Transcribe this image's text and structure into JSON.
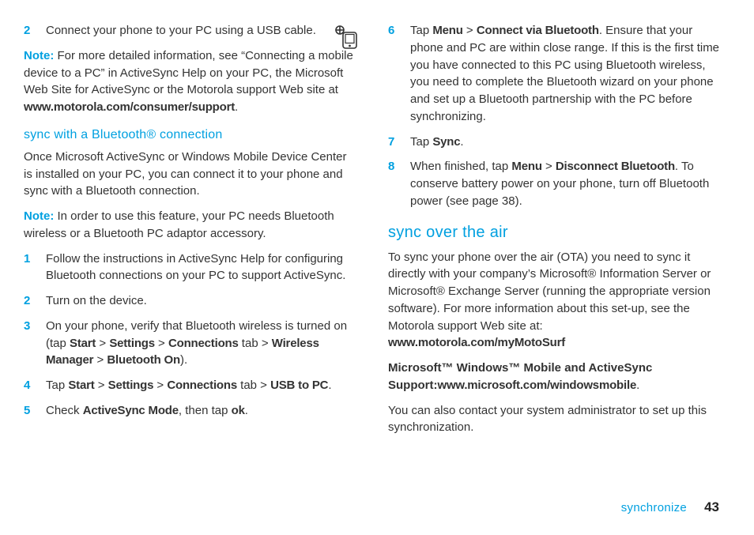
{
  "left": {
    "step2": {
      "num": "2",
      "text_a": "Connect your phone to your PC using a USB cable."
    },
    "note1_label": "Note:",
    "note1_text": " For more detailed information, see “Connecting a mobile device to a PC” in ActiveSync Help on your PC, the Microsoft Web Site for ActiveSync or the Motorola support Web site at ",
    "note1_url": "www.motorola.com/consumer/support",
    "note1_end": ".",
    "subhead": "sync with a Bluetooth® connection",
    "para1": "Once Microsoft ActiveSync or Windows Mobile Device Center is installed on your PC, you can connect it to your phone and sync with a Bluetooth connection.",
    "note2_label": "Note:",
    "note2_text": " In order to use this feature, your PC needs Bluetooth wireless or a Bluetooth PC adaptor accessory.",
    "steps_b": {
      "s1": {
        "num": "1",
        "text": "Follow the instructions in ActiveSync Help for configuring Bluetooth connections on your PC to support ActiveSync."
      },
      "s2": {
        "num": "2",
        "text": "Turn on the device."
      },
      "s3": {
        "num": "3",
        "pre": "On your phone, verify that Bluetooth wireless is turned on (tap ",
        "p1": "Start",
        "gt1": " > ",
        "p2": "Settings",
        "gt2": " > ",
        "p3": "Connections",
        "mid": " tab > ",
        "p4": "Wireless Manager",
        "gt3": " > ",
        "p5": "Bluetooth On",
        "end": ")."
      },
      "s4": {
        "num": "4",
        "pre": "Tap ",
        "p1": "Start",
        "gt1": " > ",
        "p2": "Settings",
        "gt2": " > ",
        "p3": "Connections",
        "mid": " tab > ",
        "p4": "USB to PC",
        "end": "."
      },
      "s5": {
        "num": "5",
        "pre": "Check ",
        "p1": "ActiveSync Mode",
        "mid": ", then tap ",
        "p2": "ok",
        "end": "."
      }
    }
  },
  "right": {
    "s6": {
      "num": "6",
      "pre": "Tap ",
      "p1": "Menu",
      "gt": " > ",
      "p2": "Connect via Bluetooth",
      "text": ". Ensure that your phone and PC are within close range. If this is the first time you have connected to this PC using Bluetooth wireless, you need to complete the Bluetooth wizard on your phone and set up a Bluetooth partnership with the PC before synchronizing."
    },
    "s7": {
      "num": "7",
      "pre": "Tap ",
      "p1": "Sync",
      "end": "."
    },
    "s8": {
      "num": "8",
      "pre": "When finished, tap ",
      "p1": "Menu",
      "gt": " > ",
      "p2": "Disconnect Bluetooth",
      "text": ". To conserve battery power on your phone, turn off Bluetooth power (see page 38)."
    },
    "section": "sync over the air",
    "para_ota_a": "To sync your phone over the air (OTA) you need to sync it directly with your company’s Microsoft® Information Server or Microsoft® Exchange Server (running the appropriate version software). For more information about this set-up, see the Motorola support Web site at: ",
    "url_ota": "www.motorola.com/myMotoSurf",
    "ms_line_strong": "Microsoft™ Windows™ Mobile and ActiveSync Support:",
    "ms_url": "www.microsoft.com/windowsmobile",
    "ms_end": ".",
    "para_admin": "You can also contact your system administrator to set up this synchronization."
  },
  "footer": {
    "label": "synchronize",
    "page": "43"
  }
}
